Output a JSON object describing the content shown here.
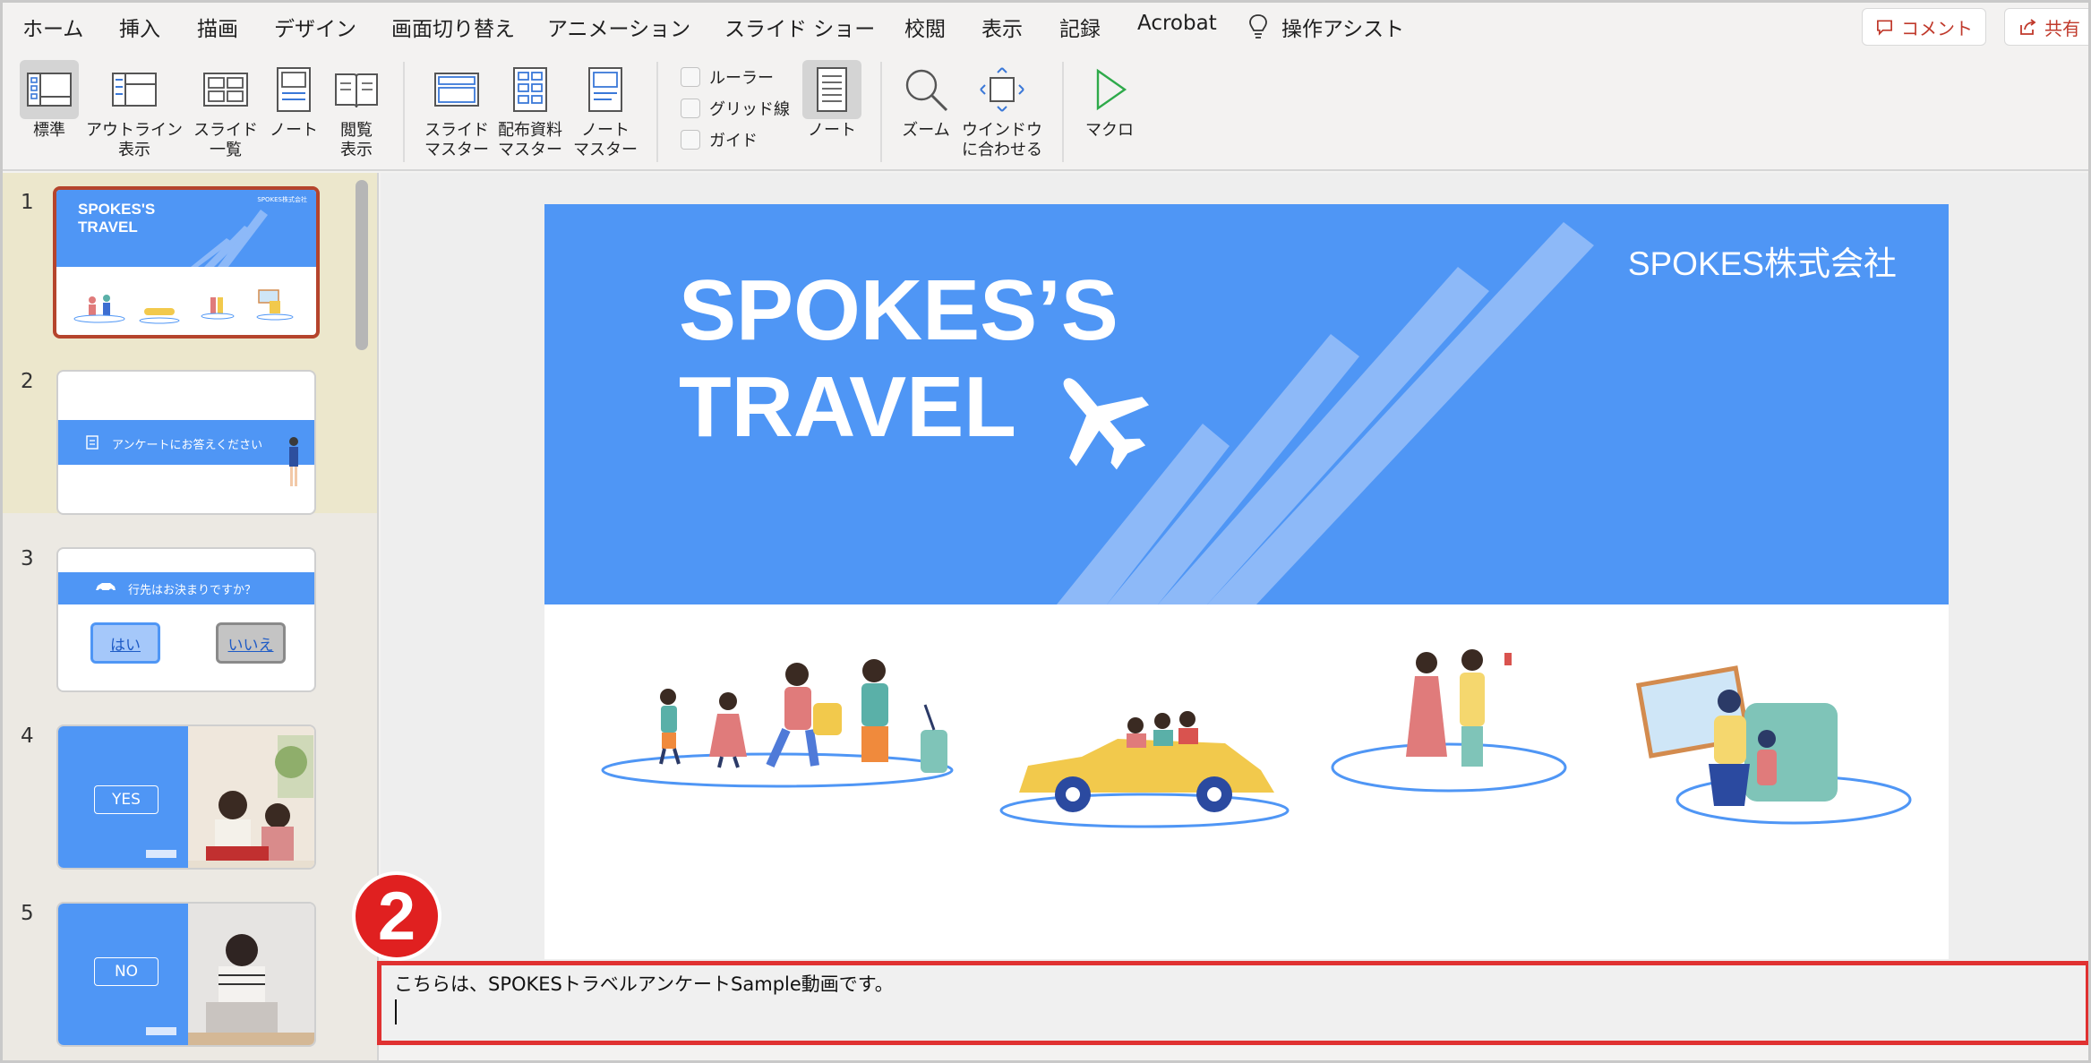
{
  "menu": {
    "tabs": [
      "ホーム",
      "挿入",
      "描画",
      "デザイン",
      "画面切り替え",
      "アニメーション",
      "スライド ショー",
      "校閲",
      "表示",
      "記録",
      "Acrobat"
    ],
    "active_tab": "表示",
    "assist": "操作アシスト",
    "comment_button": "コメント",
    "share_button": "共有"
  },
  "ribbon": {
    "normal": "標準",
    "outline": "アウトライン\n表示",
    "slide_sorter": "スライド\n一覧",
    "notes_page": "ノート",
    "reading": "閲覧\n表示",
    "slide_master": "スライド\nマスター",
    "handout_master": "配布資料\nマスター",
    "notes_master": "ノート\nマスター",
    "ruler": "ルーラー",
    "gridlines": "グリッド線",
    "guides": "ガイド",
    "notes": "ノート",
    "zoom": "ズーム",
    "fit_window": "ウインドウ\nに合わせる",
    "macro": "マクロ"
  },
  "thumbnails": {
    "numbers": [
      "1",
      "2",
      "3",
      "4",
      "5"
    ],
    "s1_title": "SPOKES'S\nTRAVEL",
    "s1_company": "SPOKES株式会社",
    "s2_text": "アンケートにお答えください",
    "s3_question": "行先はお決まりですか？",
    "s3_yes": "はい",
    "s3_no": "いいえ",
    "s4_label": "YES",
    "s5_label": "NO"
  },
  "slide": {
    "title": "SPOKES’S\nTRAVEL",
    "company": "SPOKES株式会社"
  },
  "notes": {
    "text": "こちらは、SPOKESトラベルアンケートSample動画です。"
  },
  "annotation": {
    "badge": "2"
  },
  "colors": {
    "slide_blue": "#4f96f5",
    "accent_red": "#c0392b",
    "highlight_border": "#e03131"
  }
}
